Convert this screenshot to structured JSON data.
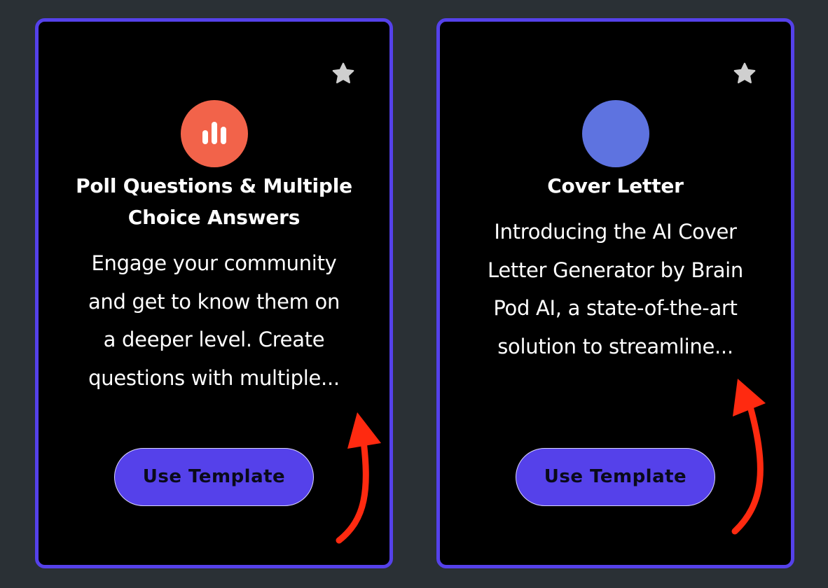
{
  "colors": {
    "page_background": "#2a3035",
    "card_background": "#000000",
    "card_border": "#5541ea",
    "button_background": "#5541ea",
    "poll_icon_circle": "#f2634a",
    "cover_icon_circle": "#5e73e0",
    "star": "#cfcfcf",
    "annotation_arrow": "#ff2a10"
  },
  "cards": [
    {
      "icon": "bar-chart-icon",
      "title_line1": "Poll Questions & Multiple",
      "title_line2": "Choice Answers",
      "desc_lines": [
        "Engage your community",
        "and get to know them on",
        "a deeper level. Create",
        "questions with multiple..."
      ],
      "button_label": "Use Template",
      "favorite_icon": "star-icon"
    },
    {
      "icon": "blue-circle-icon",
      "title_line1": "Cover Letter",
      "desc_lines": [
        "Introducing the AI Cover",
        "Letter Generator by Brain",
        "Pod AI, a state-of-the-art",
        "solution to streamline..."
      ],
      "button_label": "Use Template",
      "favorite_icon": "star-icon"
    }
  ],
  "annotations": [
    {
      "icon": "red-curved-arrow-icon"
    },
    {
      "icon": "red-curved-arrow-icon"
    }
  ]
}
